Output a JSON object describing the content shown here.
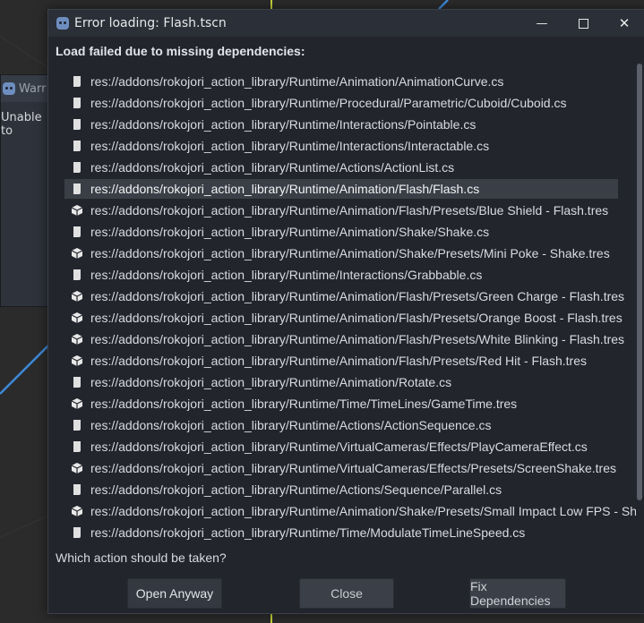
{
  "background_window": {
    "title": "Warr",
    "body_text": "Unable to"
  },
  "dialog": {
    "title": "Error loading: Flash.tscn",
    "heading": "Load failed due to missing dependencies:",
    "question": "Which action should be taken?",
    "window_controls": {
      "minimize": "—",
      "close": "✕"
    },
    "dependencies": [
      {
        "path": "res://addons/rokojori_action_library/Runtime/Animation/AnimationCurve.cs",
        "icon": "script-icon"
      },
      {
        "path": "res://addons/rokojori_action_library/Runtime/Procedural/Parametric/Cuboid/Cuboid.cs",
        "icon": "script-icon"
      },
      {
        "path": "res://addons/rokojori_action_library/Runtime/Interactions/Pointable.cs",
        "icon": "script-icon"
      },
      {
        "path": "res://addons/rokojori_action_library/Runtime/Interactions/Interactable.cs",
        "icon": "script-icon"
      },
      {
        "path": "res://addons/rokojori_action_library/Runtime/Actions/ActionList.cs",
        "icon": "script-icon"
      },
      {
        "path": "res://addons/rokojori_action_library/Runtime/Animation/Flash/Flash.cs",
        "icon": "script-icon",
        "selected": true
      },
      {
        "path": "res://addons/rokojori_action_library/Runtime/Animation/Flash/Presets/Blue Shield - Flash.tres",
        "icon": "resource-icon"
      },
      {
        "path": "res://addons/rokojori_action_library/Runtime/Animation/Shake/Shake.cs",
        "icon": "script-icon"
      },
      {
        "path": "res://addons/rokojori_action_library/Runtime/Animation/Shake/Presets/Mini Poke - Shake.tres",
        "icon": "resource-icon"
      },
      {
        "path": "res://addons/rokojori_action_library/Runtime/Interactions/Grabbable.cs",
        "icon": "script-icon"
      },
      {
        "path": "res://addons/rokojori_action_library/Runtime/Animation/Flash/Presets/Green Charge - Flash.tres",
        "icon": "resource-icon"
      },
      {
        "path": "res://addons/rokojori_action_library/Runtime/Animation/Flash/Presets/Orange Boost - Flash.tres",
        "icon": "resource-icon"
      },
      {
        "path": "res://addons/rokojori_action_library/Runtime/Animation/Flash/Presets/White Blinking - Flash.tres",
        "icon": "resource-icon"
      },
      {
        "path": "res://addons/rokojori_action_library/Runtime/Animation/Flash/Presets/Red Hit - Flash.tres",
        "icon": "resource-icon"
      },
      {
        "path": "res://addons/rokojori_action_library/Runtime/Animation/Rotate.cs",
        "icon": "script-icon"
      },
      {
        "path": "res://addons/rokojori_action_library/Runtime/Time/TimeLines/GameTime.tres",
        "icon": "resource-icon"
      },
      {
        "path": "res://addons/rokojori_action_library/Runtime/Actions/ActionSequence.cs",
        "icon": "script-icon"
      },
      {
        "path": "res://addons/rokojori_action_library/Runtime/VirtualCameras/Effects/PlayCameraEffect.cs",
        "icon": "script-icon"
      },
      {
        "path": "res://addons/rokojori_action_library/Runtime/VirtualCameras/Effects/Presets/ScreenShake.tres",
        "icon": "resource-icon"
      },
      {
        "path": "res://addons/rokojori_action_library/Runtime/Actions/Sequence/Parallel.cs",
        "icon": "script-icon"
      },
      {
        "path": "res://addons/rokojori_action_library/Runtime/Animation/Shake/Presets/Small Impact Low FPS - Shake.tres",
        "icon": "resource-icon"
      },
      {
        "path": "res://addons/rokojori_action_library/Runtime/Time/ModulateTimeLineSpeed.cs",
        "icon": "script-icon"
      }
    ],
    "buttons": {
      "open_anyway": "Open Anyway",
      "close": "Close",
      "fix_dependencies": "Fix Dependencies"
    }
  },
  "colors": {
    "dialog_bg": "#22252c",
    "titlebar_bg": "#2b2f37",
    "selection_bg": "#3a3e46",
    "viewport_line_blue": "#3d8ad9",
    "viewport_line_yellow": "#c8d437"
  }
}
